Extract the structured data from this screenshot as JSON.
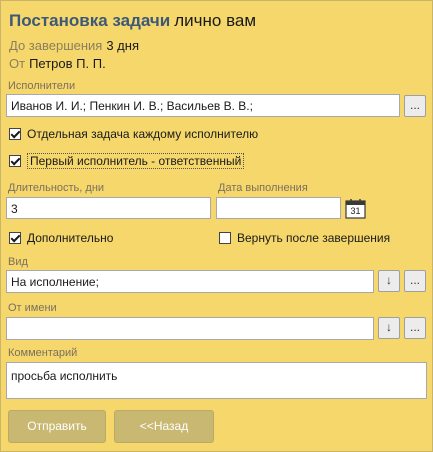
{
  "header": {
    "title": "Постановка задачи",
    "title_suffix": "лично вам",
    "deadline_label": "До завершения",
    "deadline_value": "3 дня",
    "from_label": "От",
    "from_value": "Петров П. П."
  },
  "executors": {
    "label": "Исполнители",
    "value": "Иванов И. И.; Пенкин И. В.; Васильев В. В.;",
    "browse_label": "..."
  },
  "options": {
    "separate_task": {
      "label": "Отдельная задача каждому исполнителю",
      "checked": true
    },
    "first_responsible": {
      "label": "Первый исполнитель - ответственный",
      "checked": true
    },
    "additional": {
      "label": "Дополнительно",
      "checked": true
    },
    "return_after": {
      "label": "Вернуть после завершения",
      "checked": false
    }
  },
  "duration": {
    "label": "Длительность, дни",
    "value": "3"
  },
  "due_date": {
    "label": "Дата выполнения",
    "value": "",
    "calendar_day": "31"
  },
  "kind": {
    "label": "Вид",
    "value": "На исполнение;",
    "arrow_label": "↓",
    "browse_label": "..."
  },
  "on_behalf": {
    "label": "От имени",
    "value": "",
    "arrow_label": "↓",
    "browse_label": "..."
  },
  "comment": {
    "label": "Комментарий",
    "value": "просьба исполнить"
  },
  "actions": {
    "send_label": "Отправить",
    "back_label": "<<Назад"
  },
  "colors": {
    "panel_bg": "#f5d76b",
    "title": "#3d5878",
    "button_bg": "#c8b871"
  }
}
